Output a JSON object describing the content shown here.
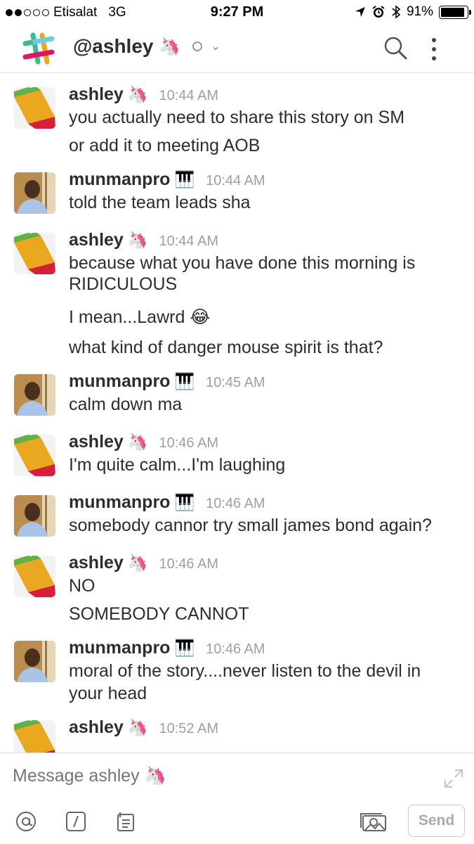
{
  "status_bar": {
    "carrier": "Etisalat",
    "network": "3G",
    "time": "9:27 PM",
    "battery": "91%",
    "battery_level": 0.91,
    "signal_bars_filled": 2,
    "signal_bars_total": 5
  },
  "header": {
    "channel_name": "@ashley",
    "channel_emoji": "🦄",
    "icons": [
      "slack-logo",
      "presence-indicator",
      "chevron-down-icon",
      "search-icon",
      "more-vertical-icon"
    ]
  },
  "messages": [
    {
      "author": "ashley",
      "emoji": "🦄",
      "time": "10:44 AM",
      "avatar": "slack-logo-avatar",
      "lines": [
        "you actually need to share this story on SM",
        "or add it to meeting AOB"
      ]
    },
    {
      "author": "munmanpro",
      "emoji": "🎹",
      "time": "10:44 AM",
      "avatar": "photo-avatar",
      "lines": [
        "told the team leads sha"
      ]
    },
    {
      "author": "ashley",
      "emoji": "🦄",
      "time": "10:44 AM",
      "avatar": "slack-logo-avatar",
      "lines": [
        "because what you have done this morning is",
        "RIDICULOUS",
        "I mean...Lawrd 😂",
        "what kind of danger mouse spirit is that?"
      ]
    },
    {
      "author": "munmanpro",
      "emoji": "🎹",
      "time": "10:45 AM",
      "avatar": "photo-avatar",
      "lines": [
        "calm down ma"
      ]
    },
    {
      "author": "ashley",
      "emoji": "🦄",
      "time": "10:46 AM",
      "avatar": "slack-logo-avatar",
      "lines": [
        "I'm quite calm...I'm laughing"
      ]
    },
    {
      "author": "munmanpro",
      "emoji": "🎹",
      "time": "10:46 AM",
      "avatar": "photo-avatar",
      "lines": [
        "somebody cannor try small james bond again?"
      ]
    },
    {
      "author": "ashley",
      "emoji": "🦄",
      "time": "10:46 AM",
      "avatar": "slack-logo-avatar",
      "lines": [
        "NO",
        "SOMEBODY CANNOT"
      ]
    },
    {
      "author": "munmanpro",
      "emoji": "🎹",
      "time": "10:46 AM",
      "avatar": "photo-avatar",
      "lines": [
        "moral of the story....never listen to the devil in",
        "your head"
      ]
    },
    {
      "author": "ashley",
      "emoji": "🦄",
      "time": "10:52 AM",
      "avatar": "slack-logo-avatar",
      "lines": []
    }
  ],
  "composer": {
    "placeholder": "Message ashley 🦄",
    "send_label": "Send",
    "icons": [
      "at-icon",
      "slash-command-icon",
      "file-icon",
      "photo-icon",
      "expand-icon"
    ]
  },
  "colors": {
    "text": "#2c2d30",
    "timestamp": "#9e9ea6",
    "placeholder": "#a0a0a6",
    "divider": "#e3e3e3"
  }
}
